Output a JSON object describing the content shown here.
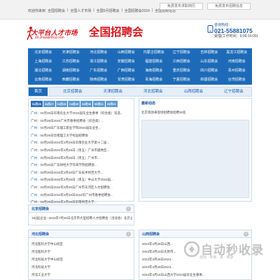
{
  "topbar": {
    "links": [
      "欢迎你来到",
      "全国招聘会",
      "|",
      "全国人才市场",
      "|",
      "全国5月招聘会",
      "|",
      "全国招聘会2024",
      "|",
      "全国招聘信息"
    ],
    "publish_jobseeker": "免费发布求职简历",
    "publish_jobs": "免费发布招聘信息"
  },
  "header": {
    "logo_main": "大平台人才市场",
    "logo_url": "sh.zhaopinhui.com",
    "tagline": "全国招聘会",
    "hotline_label": "咨询热线：",
    "hotline_number": "021-55881075",
    "hotline_hours": "受理(工作时间：9:00-16:00)"
  },
  "cities": [
    "北京招聘会",
    "天津招聘会",
    "河北招聘会",
    "山西招聘会",
    "内蒙古招聘会",
    "辽宁招聘会",
    "吉林招聘会",
    "黑龙江招聘会",
    "上海招聘会",
    "江苏招聘会",
    "浙江招聘会",
    "安徽招聘会",
    "福建招聘会",
    "江西招聘会",
    "山东招聘会",
    "河南招聘会",
    "湖北招聘会",
    "湖南招聘会",
    "广东招聘会",
    "广西招聘会",
    "海南招聘会",
    "重庆招聘会",
    "四川招聘会",
    "贵州招聘会",
    "云南招聘会",
    "西藏招聘会",
    "陕西招聘会",
    "甘肃招聘会",
    "青海招聘会",
    "宁夏招聘会",
    "新疆招聘会",
    "台湾招聘会"
  ],
  "region_tabs": [
    "首页",
    "北京招聘会",
    "天津招聘会",
    "河北招聘会",
    "山西招聘会",
    "辽宁招聘会"
  ],
  "date_tabs": [
    "04月26日",
    "04月27日",
    "04月28日",
    "04月29日",
    "04月30日",
    "05月01日",
    "05月02日"
  ],
  "news": [
    {
      "city": "广州：",
      "text": "04月26日华南农业大学2024届毕业生春季（综合类）双选..."
    },
    {
      "city": "",
      "text": "广州：04月26日2024广州市春季招聘会（综合类）..."
    },
    {
      "city": "广州：",
      "text": "04月26日广东理工职业学院2024届毕业生..."
    },
    {
      "city": "广州：",
      "text": "04月26日华南理工大学校园招聘会"
    },
    {
      "city": "",
      "text": "广州：04月26日2024年4月26日华南农业大学第十二届..."
    },
    {
      "city": "",
      "text": "广州：04月26日2024年4月26日（周五）广州市越秀区..."
    },
    {
      "city": "广州：",
      "text": "04月26日2024年4月26日（周五）广州市..."
    },
    {
      "city": "广州：",
      "text": "04月26日广东财经大学华商学院招聘会..."
    },
    {
      "city": "",
      "text": "广州：03月30日2024年3月30日广东技术师范大学..."
    },
    {
      "city": "广州：",
      "text": "04月26日2024年4月26日（周五）中山大学2024届..."
    },
    {
      "city": "",
      "text": "广州：03月30日2024年3月30日广州市天河区人才招聘会..."
    },
    {
      "city": "广州：",
      "text": "03月30日2024年3月30日2024年广州市春季招聘会..."
    },
    {
      "city": "",
      "text": "广州：04月26日2024年4月26日华南师范大学..."
    },
    {
      "city": "广州：",
      "text": "03月30日2024年3月30日华南理工大学2024届毕业..."
    }
  ],
  "right_panel": {
    "title": "最新动态",
    "item": "北京现场来现场招聘会招聘30名"
  },
  "beijing": {
    "title": "北京招聘会",
    "text": "18(届)企业--2023年7月30日北京市大型招聘人才招聘会（洽谈会）北京立水路..."
  },
  "hebei": {
    "title": "河北招聘会",
    "items": [
      "河北医科大学中山校区",
      "河北医科大学",
      "河北科技大学中山校区",
      "河北科技大学",
      "河北工业大学"
    ]
  },
  "shanxi": {
    "title": "山西招聘会",
    "items": [
      "2023年3月29日山西...",
      "2023年3月23日太原市...",
      "2023年3月26日2023...",
      "2023年3月28日2023...",
      "2024年3月16日山西大学2024届毕业生春季..."
    ]
  },
  "watermark": {
    "text": "自动秒收录",
    "sub": "自动 · 秒收 · 录 · 收录"
  }
}
